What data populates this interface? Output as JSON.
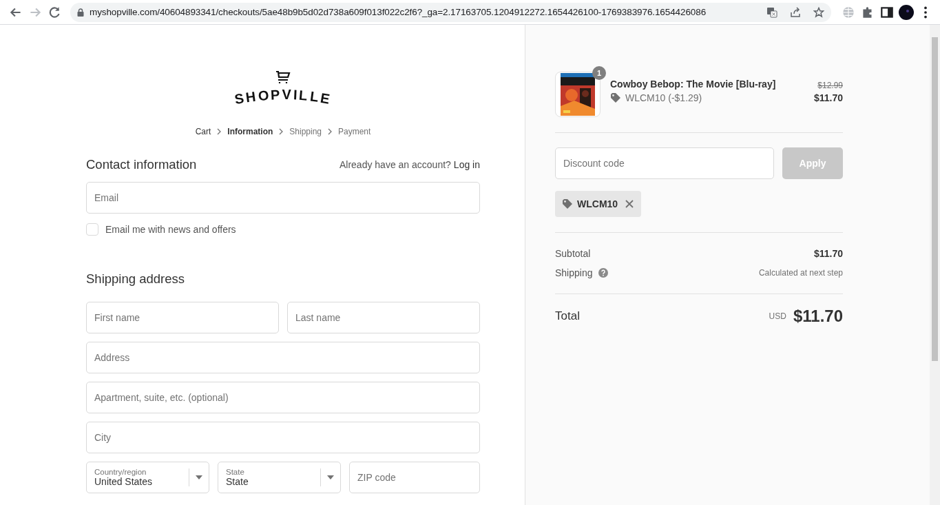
{
  "browser": {
    "url": "myshopville.com/40604893341/checkouts/5ae48b9b5d02d738a609f013f022c2f6?_ga=2.17163705.1204912272.1654426100-1769383976.1654426086",
    "forward_disabled": true
  },
  "logo": {
    "text": "SHOPVILLE"
  },
  "breadcrumb": [
    {
      "label": "Cart",
      "selected": false
    },
    {
      "label": "Information",
      "selected": true
    },
    {
      "label": "Shipping",
      "selected": false
    },
    {
      "label": "Payment",
      "selected": false
    }
  ],
  "contact": {
    "heading": "Contact information",
    "account_prompt": "Already have an account?",
    "login_link": "Log in",
    "email": {
      "placeholder": "Email"
    },
    "newsletter": {
      "label": "Email me with news and offers",
      "checked": false
    }
  },
  "shipping_address": {
    "heading": "Shipping address",
    "fields": [
      {
        "items": [
          {
            "kind": "input",
            "placeholder": "First name"
          },
          {
            "kind": "input",
            "placeholder": "Last name"
          }
        ]
      },
      {
        "items": [
          {
            "kind": "input",
            "placeholder": "Address"
          }
        ]
      },
      {
        "items": [
          {
            "kind": "input",
            "placeholder": "Apartment, suite, etc. (optional)"
          }
        ]
      },
      {
        "items": [
          {
            "kind": "input",
            "placeholder": "City"
          }
        ]
      },
      {
        "items": [
          {
            "kind": "select",
            "label": "Country/region",
            "value": "United States"
          },
          {
            "kind": "select",
            "label": "State",
            "value": "State"
          },
          {
            "kind": "input",
            "placeholder": "ZIP code"
          }
        ]
      }
    ]
  },
  "summary": {
    "product": {
      "kind": "picture",
      "quantity": "1",
      "name": "Cowboy Bebop: The Movie [Blu-ray]",
      "discount": "WLCM10 (-$1.29)",
      "original_price": "$12.99",
      "price": "$11.70"
    },
    "discount_field": {
      "placeholder": "Discount code"
    },
    "apply_button": {
      "label": "Apply",
      "disabled": true
    },
    "applied_code": "WLCM10",
    "subtotal": {
      "label": "Subtotal",
      "value": "$11.70"
    },
    "shipping": {
      "label": "Shipping",
      "value": "Calculated at next step"
    },
    "total": {
      "label": "Total",
      "currency": "USD",
      "value": "$11.70"
    }
  }
}
